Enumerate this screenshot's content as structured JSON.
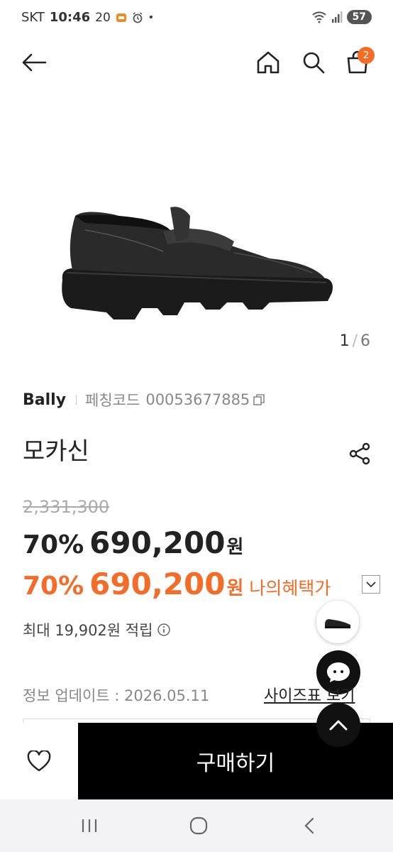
{
  "status_bar": {
    "carrier": "SKT",
    "time": "10:46",
    "temperature": "20",
    "dot": "•",
    "battery": "57"
  },
  "header": {
    "cart_count": "2",
    "icons": [
      "back-arrow-icon",
      "home-icon",
      "search-icon",
      "shopping-bag-icon"
    ]
  },
  "gallery": {
    "current": "1",
    "separator": "/",
    "total": "6"
  },
  "product": {
    "brand": "Bally",
    "code_label": "페칭코드",
    "code": "00053677885",
    "title": "모카신",
    "original_price": "2,331,300",
    "discount_percent": "70%",
    "price": "690,200",
    "currency": "원",
    "benefit_percent": "70%",
    "benefit_price": "690,200",
    "benefit_label": "나의혜택가",
    "points_text": "최대 19,902원 적립",
    "update_text": "정보 업데이트 : 2026.05.11",
    "size_chart_link": "사이즈표 보기"
  },
  "actions": {
    "buy_label": "구매하기"
  },
  "colors": {
    "accent": "#f46c28",
    "buy_bg": "#000000",
    "strikethrough": "#aaaaaa"
  }
}
